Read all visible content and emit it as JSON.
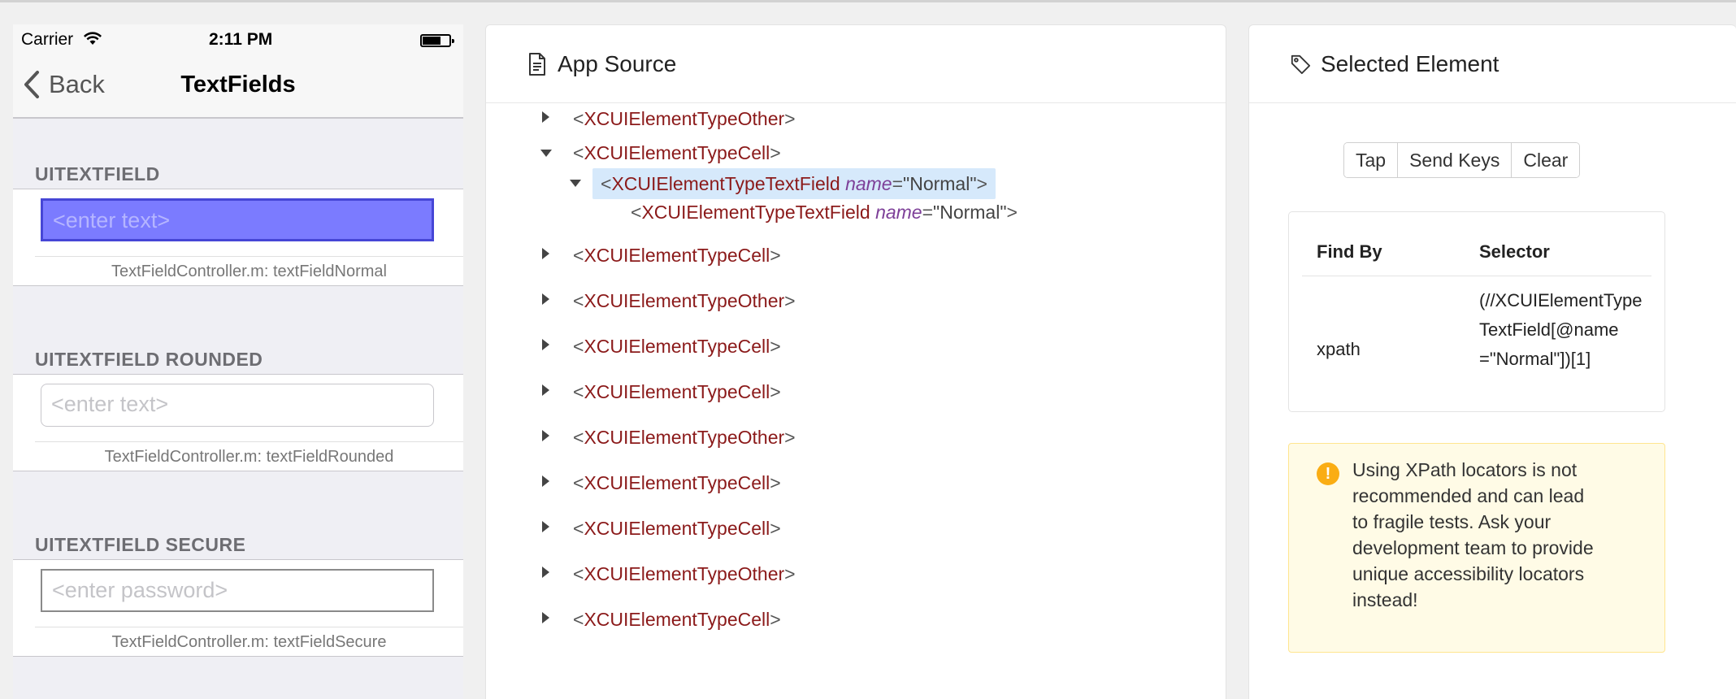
{
  "device": {
    "status": {
      "carrier": "Carrier",
      "time": "2:11 PM"
    },
    "nav": {
      "back_label": "Back",
      "title": "TextFields"
    },
    "sections": [
      {
        "header": "UITEXTFIELD",
        "placeholder": "<enter text>",
        "caption": "TextFieldController.m: textFieldNormal"
      },
      {
        "header": "UITEXTFIELD ROUNDED",
        "placeholder": "<enter text>",
        "caption": "TextFieldController.m: textFieldRounded"
      },
      {
        "header": "UITEXTFIELD SECURE",
        "placeholder": "<enter password>",
        "caption": "TextFieldController.m: textFieldSecure"
      }
    ],
    "highlight_color": "#7b7bff"
  },
  "source_panel": {
    "title": "App Source",
    "nodes": [
      {
        "tag": "XCUIElementTypeOther"
      },
      {
        "tag": "XCUIElementTypeCell"
      },
      {
        "tag": "XCUIElementTypeTextField",
        "attr": "name",
        "value": "\"Normal\""
      },
      {
        "tag": "XCUIElementTypeTextField",
        "attr": "name",
        "value": "\"Normal\""
      },
      {
        "tag": "XCUIElementTypeCell"
      },
      {
        "tag": "XCUIElementTypeOther"
      },
      {
        "tag": "XCUIElementTypeCell"
      },
      {
        "tag": "XCUIElementTypeCell"
      },
      {
        "tag": "XCUIElementTypeOther"
      },
      {
        "tag": "XCUIElementTypeCell"
      },
      {
        "tag": "XCUIElementTypeCell"
      },
      {
        "tag": "XCUIElementTypeOther"
      },
      {
        "tag": "XCUIElementTypeCell"
      }
    ]
  },
  "selected_panel": {
    "title": "Selected Element",
    "buttons": {
      "tap": "Tap",
      "send_keys": "Send Keys",
      "clear": "Clear"
    },
    "table": {
      "col_find_by": "Find By",
      "col_selector": "Selector",
      "find_by": "xpath",
      "selector": "(//XCUIElementTypeTextField[@name=\"Normal\"])[1]"
    },
    "alert": "Using XPath locators is not recommended and can lead to fragile tests. Ask your development team to provide unique accessibility locators instead!",
    "alert_icon": "!"
  }
}
